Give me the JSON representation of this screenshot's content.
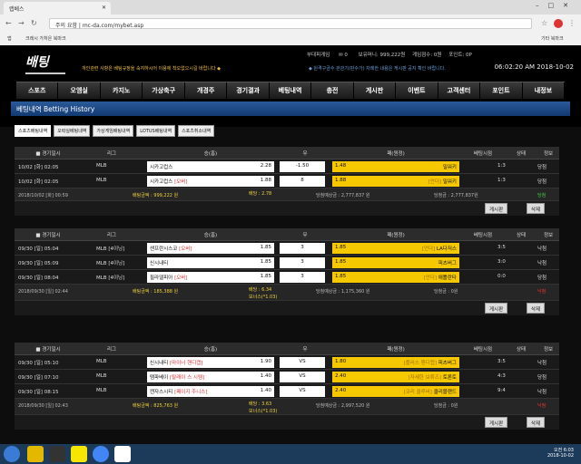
{
  "browser": {
    "tab_title": "랩베스",
    "url": "주의 요함 | mc-da.com/mybet.asp",
    "bookmarks": [
      "앱",
      "크레시 가처은 북마크"
    ],
    "other_bookmarks": "기타 북마크"
  },
  "site": {
    "notice_left": "개인관련 사항은 베팅규정을 숙지하시어 이용에 착오없으시길 바랍니다 ◆",
    "notice_right": "◆ 원격구금수 관관기(판수가) 차례한 내용은 게시판 공지 확인 바랍니다.",
    "user": {
      "name": "부대피게임",
      "msgs": "0",
      "money_label": "보유머니:",
      "money": "999,222원",
      "point_label": "게임점수: 0원",
      "point2": "포인트: 0P"
    },
    "clock": "06:02:20 AM 2018-10-02",
    "menu": [
      "스포츠",
      "오엠실",
      "카지노",
      "가상축구",
      "개경주",
      "경기결과",
      "베팅내역",
      "충전",
      "게시판",
      "이벤트",
      "고객센터",
      "포인트",
      "내정보"
    ],
    "page_title": "베팅내역 Betting History",
    "subtabs": [
      "스포츠배팅내역",
      "오락실베팅내역",
      "가상게임배팅내역",
      "LOTUS베팅내역",
      "스포츠취소내역"
    ],
    "headers": [
      "경기일시",
      "리그",
      "승(홈)",
      "무",
      "패(원정)",
      "베팅시점",
      "상태",
      "정보"
    ],
    "blocks": [
      {
        "rows": [
          {
            "time": "10/02 [화] 02:05",
            "league": "MLB",
            "home": "시카고컵스",
            "home_tag": "",
            "home_odd": "2.28",
            "mid": "-1.50",
            "away": "1.48",
            "away_name": "밀워키",
            "away_tag": "",
            "score": "1:3",
            "result": "당첨"
          },
          {
            "time": "10/02 [화] 02:05",
            "league": "MLB",
            "home": "시카고컵스",
            "home_tag": "[오버]",
            "home_odd": "1.88",
            "mid": "8",
            "away": "1.88",
            "away_name": "밀워키",
            "away_tag": "[언더]",
            "score": "1:3",
            "result": "당첨"
          }
        ],
        "summary": {
          "date": "2018/10/02 [화] 00:59",
          "bet": "배팅금액 : 999,222 원",
          "rate": "배당 : 2.78",
          "expect": "당첨예상금 : 2,777,837 원",
          "win": "당첨금 : 2,777,837원",
          "status": "당첨"
        }
      },
      {
        "rows": [
          {
            "time": "09/30 [일] 05:04",
            "league": "MLB [4이닝]",
            "home": "샌프란시스코",
            "home_tag": "[오버]",
            "home_odd": "1.85",
            "mid": "3",
            "away": "1.85",
            "away_name": "LA다저스",
            "away_tag": "[언더]",
            "score": "3:5",
            "result": "낙첨"
          },
          {
            "time": "09/30 [일] 05:09",
            "league": "MLB [4이닝]",
            "home": "신시내티",
            "home_tag": "",
            "home_odd": "1.85",
            "mid": "3",
            "away": "1.85",
            "away_name": "피츠버그",
            "away_tag": "",
            "score": "3:0",
            "result": "낙첨"
          },
          {
            "time": "09/30 [일] 08:04",
            "league": "MLB [4이닝]",
            "home": "필라델피아",
            "home_tag": "[오버]",
            "home_odd": "1.85",
            "mid": "3",
            "away": "1.85",
            "away_name": "애틀란타",
            "away_tag": "[언더]",
            "score": "0:0",
            "result": "당첨"
          }
        ],
        "summary": {
          "date": "2018/09/30 [일] 02:44",
          "bet": "배팅금액 : 185,388 원",
          "rate": "배당 : 6.34",
          "bonus": "보너스(*1.03)",
          "expect": "당첨예상금 : 1,175,360 원",
          "win": "당첨금 : 0원",
          "status": "낙첨"
        }
      },
      {
        "rows": [
          {
            "time": "09/30 [일] 05:10",
            "league": "MLB",
            "home": "신시내티",
            "home_tag": "[마이너 핸디캡]",
            "home_odd": "1.90",
            "mid": "VS",
            "away": "1.80",
            "away_name": "피츠버그",
            "away_tag": "[플러스 핸디캡]",
            "score": "3:5",
            "result": "낙첨"
          },
          {
            "time": "09/30 [일] 07:10",
            "league": "MLB",
            "home": "탬파베이",
            "home_tag": "[탈래이 스 시템]",
            "home_odd": "1.40",
            "mid": "VS",
            "away": "2.40",
            "away_name": "토론토",
            "away_tag": "[자세한 보류즈]",
            "score": "4:3",
            "result": "당첨"
          },
          {
            "time": "09/30 [일] 08:15",
            "league": "MLB",
            "home": "캔자스시티",
            "home_tag": "[페이지 주니스]",
            "home_odd": "1.40",
            "mid": "VS",
            "away": "2.40",
            "away_name": "클리블랜드",
            "away_tag": "[코리 클루버]",
            "score": "9:4",
            "result": "낙첨"
          }
        ],
        "summary": {
          "date": "2018/09/30 [일] 02:43",
          "bet": "배팅금액 : 825,763 원",
          "rate": "배당 : 3.63",
          "bonus": "보너스(*1.03)",
          "expect": "당첨예상금 : 2,997,520 원",
          "win": "당첨금 : 0원",
          "status": "낙첨"
        }
      }
    ],
    "btn_view": "게시판",
    "btn_del": "삭제"
  },
  "taskbar": {
    "time": "오전 6:03",
    "date": "2018-10-02"
  }
}
